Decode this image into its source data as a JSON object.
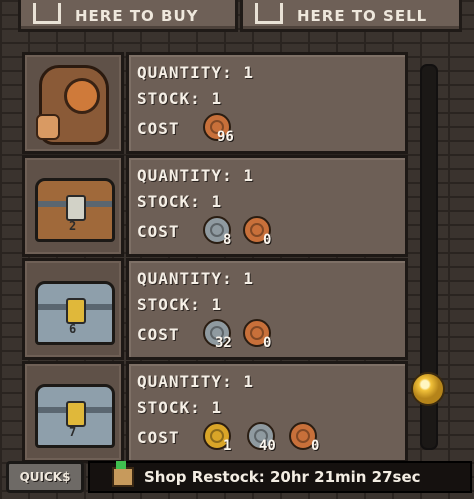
{
  "top_buttons": {
    "buy": {
      "label": "HERE TO BUY",
      "icon": "download-tray-icon"
    },
    "sell": {
      "label": "HERE TO SELL",
      "icon": "upload-tray-icon"
    }
  },
  "labels": {
    "quantity": "QUANTITY:",
    "stock": "STOCK:",
    "cost": "COST"
  },
  "items": [
    {
      "icon": "coin-bag-icon",
      "quantity": "1",
      "stock": "1",
      "costs": [
        {
          "type": "copper",
          "amount": "96"
        }
      ]
    },
    {
      "icon": "wooden-chest-icon",
      "chest_number": "2",
      "quantity": "1",
      "stock": "1",
      "costs": [
        {
          "type": "silver",
          "amount": "8"
        },
        {
          "type": "copper",
          "amount": "0"
        }
      ]
    },
    {
      "icon": "steel-chest-icon",
      "chest_number": "6",
      "quantity": "1",
      "stock": "1",
      "costs": [
        {
          "type": "silver",
          "amount": "32"
        },
        {
          "type": "copper",
          "amount": "0"
        }
      ]
    },
    {
      "icon": "steel-chest-icon",
      "chest_number": "7",
      "quantity": "1",
      "stock": "1",
      "costs": [
        {
          "type": "gold",
          "amount": "1"
        },
        {
          "type": "silver",
          "amount": "40"
        },
        {
          "type": "copper",
          "amount": "0"
        }
      ]
    }
  ],
  "bottom": {
    "quick_label": "QUICK$",
    "restock_text": "Shop Restock: 20hr 21min 27sec",
    "restock_icon": "gift-box-icon"
  },
  "colors": {
    "copper": "#c8703a",
    "silver": "#8f9aa0",
    "gold": "#d9a528"
  }
}
